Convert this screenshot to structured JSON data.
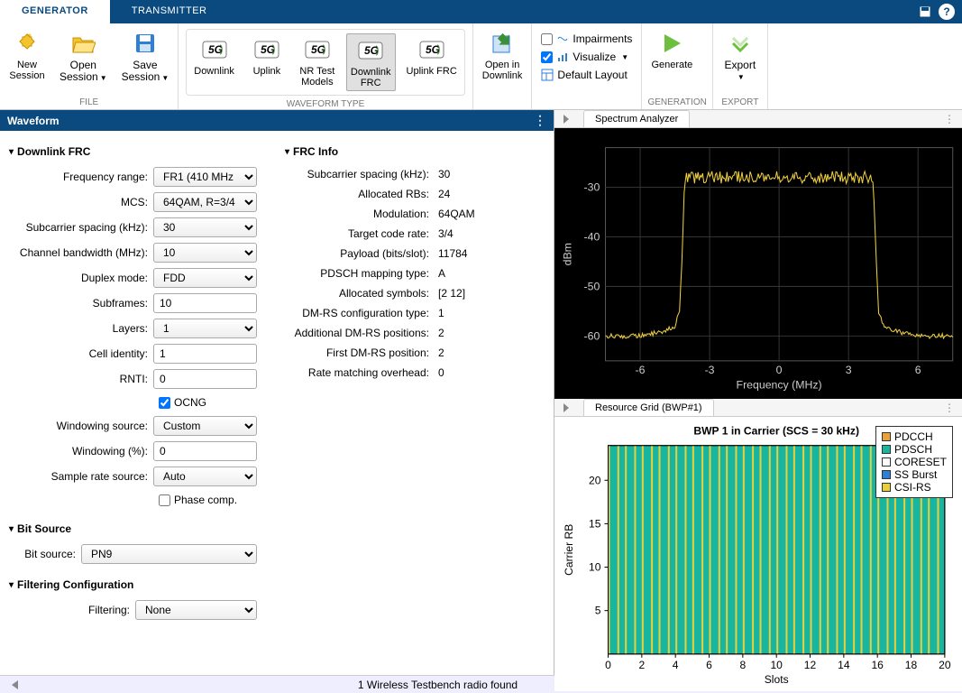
{
  "tabs": {
    "generator": "GENERATOR",
    "transmitter": "TRANSMITTER"
  },
  "tool": {
    "file": {
      "new": "New\nSession",
      "open": "Open\nSession",
      "save": "Save\nSession",
      "group": "FILE"
    },
    "wave": {
      "downlink": "Downlink",
      "uplink": "Uplink",
      "nrtest": "NR Test\nModels",
      "dfrc": "Downlink\nFRC",
      "ufrc": "Uplink FRC",
      "group": "WAVEFORM TYPE"
    },
    "openin": "Open in\nDownlink",
    "opts": {
      "imp": "Impairments",
      "vis": "Visualize",
      "layout": "Default Layout",
      "group": "GENERATION"
    },
    "generate": "Generate",
    "export": "Export",
    "exportgrp": "EXPORT"
  },
  "waveform_hdr": "Waveform",
  "sections": {
    "dfrc": "Downlink FRC",
    "bitsrc": "Bit Source",
    "filt": "Filtering Configuration",
    "frcinfo": "FRC Info"
  },
  "labels": {
    "freq": "Frequency range:",
    "mcs": "MCS:",
    "scs": "Subcarrier spacing (kHz):",
    "bw": "Channel bandwidth (MHz):",
    "dup": "Duplex mode:",
    "subf": "Subframes:",
    "layers": "Layers:",
    "cell": "Cell identity:",
    "rnti": "RNTI:",
    "ocng": "OCNG",
    "wsrc": "Windowing source:",
    "wpct": "Windowing (%):",
    "srate": "Sample rate source:",
    "phase": "Phase comp.",
    "bitsrc": "Bit source:",
    "filter": "Filtering:"
  },
  "values": {
    "freq": "FR1 (410 MHz ...",
    "mcs": "64QAM, R=3/4",
    "scs": "30",
    "bw": "10",
    "dup": "FDD",
    "subf": "10",
    "layers": "1",
    "cell": "1",
    "rnti": "0",
    "ocng": true,
    "wsrc": "Custom",
    "wpct": "0",
    "srate": "Auto",
    "phase": false,
    "bitsrc": "PN9",
    "filter": "None"
  },
  "infolabels": {
    "scs": "Subcarrier spacing (kHz):",
    "rb": "Allocated RBs:",
    "mod": "Modulation:",
    "tcr": "Target code rate:",
    "pl": "Payload (bits/slot):",
    "map": "PDSCH mapping type:",
    "sym": "Allocated symbols:",
    "dmrs": "DM-RS configuration type:",
    "admrs": "Additional DM-RS positions:",
    "fdmrs": "First DM-RS position:",
    "rmo": "Rate matching overhead:"
  },
  "infovalues": {
    "scs": "30",
    "rb": "24",
    "mod": "64QAM",
    "tcr": "3/4",
    "pl": "11784",
    "map": "A",
    "sym": "[2 12]",
    "dmrs": "1",
    "admrs": "2",
    "fdmrs": "2",
    "rmo": "0"
  },
  "panels": {
    "spectrum": "Spectrum Analyzer",
    "grid": "Resource Grid (BWP#1)"
  },
  "status": "1 Wireless Testbench radio found",
  "chart_data": [
    {
      "type": "line",
      "title": "",
      "xlabel": "Frequency (MHz)",
      "ylabel": "dBm",
      "xticks": [
        -6,
        -3,
        0,
        3,
        6
      ],
      "yticks": [
        -30,
        -40,
        -50,
        -60
      ],
      "xlim": [
        -7.5,
        7.5
      ],
      "ylim": [
        -65,
        -22
      ],
      "series": [
        {
          "name": "spectrum",
          "color": "#f0d040",
          "x": [
            -7.5,
            -6,
            -5,
            -4.5,
            -4.3,
            -4.2,
            -4.1,
            -4,
            4,
            4.1,
            4.2,
            4.3,
            4.5,
            5,
            6,
            7.5
          ],
          "y": [
            -60,
            -60,
            -59,
            -58,
            -55,
            -45,
            -32,
            -28,
            -28,
            -32,
            -45,
            -55,
            -58,
            -59,
            -60,
            -60
          ]
        }
      ]
    },
    {
      "type": "area",
      "title": "BWP 1 in Carrier (SCS = 30 kHz)",
      "xlabel": "Slots",
      "ylabel": "Carrier RB",
      "xlim": [
        0,
        20
      ],
      "ylim": [
        0,
        24
      ],
      "xticks": [
        0,
        2,
        4,
        6,
        8,
        10,
        12,
        14,
        16,
        18,
        20
      ],
      "yticks": [
        5,
        10,
        15,
        20
      ],
      "legend": [
        "PDCCH",
        "PDSCH",
        "CORESET",
        "SS Burst",
        "CSI-RS"
      ],
      "legend_colors": [
        "#e8a23c",
        "#18b5a0",
        "#ffffff",
        "#2f7fd4",
        "#e8d03c"
      ]
    }
  ]
}
